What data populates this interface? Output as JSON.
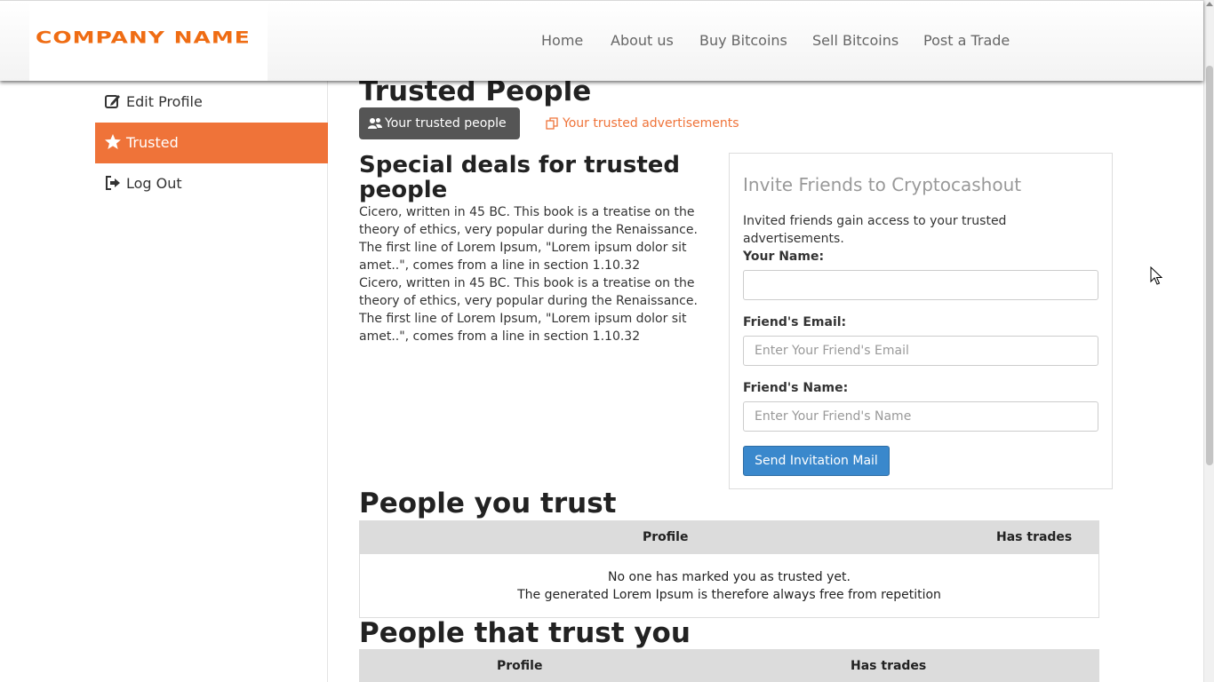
{
  "brand": {
    "logo_text": "COMPANY NAME",
    "accent_color": "#ef7339"
  },
  "nav": {
    "items": [
      {
        "label": "Home"
      },
      {
        "label": "About us"
      },
      {
        "label": "Buy Bitcoins"
      },
      {
        "label": "Sell Bitcoins"
      },
      {
        "label": "Post a Trade"
      }
    ]
  },
  "sidebar": {
    "items": [
      {
        "label": "Edit Profile",
        "icon": "edit-icon",
        "active": false
      },
      {
        "label": "Trusted",
        "icon": "star-icon",
        "active": true
      },
      {
        "label": "Log Out",
        "icon": "logout-icon",
        "active": false
      }
    ]
  },
  "main": {
    "title": "Trusted People",
    "tabs": [
      {
        "label": "Your trusted people",
        "icon": "users-icon",
        "active": true
      },
      {
        "label": "Your trusted advertisements",
        "icon": "copy-icon",
        "active": false
      }
    ],
    "deals": {
      "title": "Special deals for trusted people",
      "paragraphs": [
        "Cicero, written in 45 BC. This book is a treatise on the theory of ethics, very popular during the Renaissance. The first line of Lorem Ipsum, \"Lorem ipsum dolor sit amet..\", comes from a line in section 1.10.32",
        "Cicero, written in 45 BC. This book is a treatise on the theory of ethics, very popular during the Renaissance. The first line of Lorem Ipsum, \"Lorem ipsum dolor sit amet..\", comes from a line in section 1.10.32"
      ]
    }
  },
  "invite": {
    "title": "Invite Friends to Cryptocashout",
    "description": "Invited friends gain access to your trusted advertisements.",
    "your_name": {
      "label": "Your Name:",
      "value": "",
      "placeholder": ""
    },
    "friend_email": {
      "label": "Friend's Email:",
      "value": "",
      "placeholder": "Enter Your Friend's Email"
    },
    "friend_name": {
      "label": "Friend's Name:",
      "value": "",
      "placeholder": "Enter Your Friend's Name"
    },
    "button_label": "Send Invitation Mail"
  },
  "people_you_trust": {
    "title": "People you trust",
    "columns": [
      "Profile",
      "Has trades"
    ],
    "empty_line1": "No one has marked you as trusted yet.",
    "empty_line2": "The generated Lorem Ipsum is therefore always free from repetition"
  },
  "people_that_trust_you": {
    "title": "People that trust you",
    "columns": [
      "Profile",
      "Has trades"
    ]
  }
}
